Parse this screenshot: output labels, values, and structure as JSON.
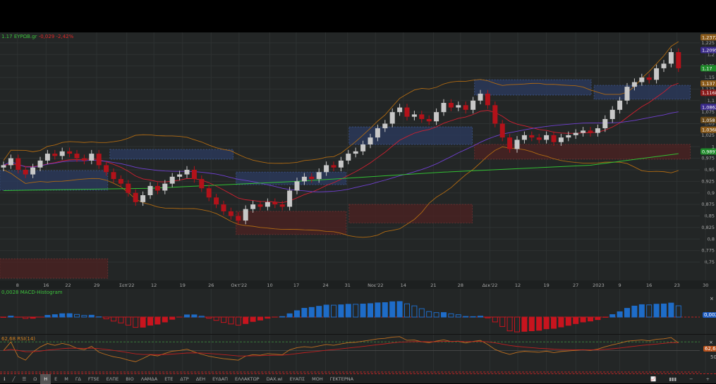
{
  "symbol": {
    "price": "1.17",
    "name": "ΕΥΡΩΒ.gr",
    "change": "-0,029",
    "change_pct": "-2,42%"
  },
  "macd": {
    "label": "MACD-Histogram",
    "value": "0,0028"
  },
  "rsi": {
    "label": "RSI(14)",
    "value": "62,68",
    "level": "50"
  },
  "colors": {
    "up": "#c8c8c8",
    "down": "#b3121a",
    "bb": "#b06a12",
    "green": "#33c033",
    "purple": "#7040d0",
    "red": "#d02030",
    "sar": "#5a5ab8",
    "zone_blue": "#2a3a5c",
    "zone_red": "#4a2222",
    "macd_up": "#1e6cc8",
    "macd_down": "#c8141e",
    "bg": "#232626",
    "grid": "#2e3232"
  },
  "chart_data": {
    "type": "candlestick",
    "ylim": [
      0.74,
      1.25
    ],
    "closes": [
      0.96,
      0.975,
      0.95,
      0.94,
      0.955,
      0.97,
      0.985,
      0.98,
      0.99,
      0.985,
      0.975,
      0.97,
      0.985,
      0.96,
      0.945,
      0.93,
      0.92,
      0.9,
      0.88,
      0.895,
      0.915,
      0.905,
      0.92,
      0.935,
      0.94,
      0.95,
      0.93,
      0.91,
      0.89,
      0.875,
      0.86,
      0.85,
      0.84,
      0.865,
      0.875,
      0.87,
      0.88,
      0.875,
      0.87,
      0.905,
      0.925,
      0.935,
      0.93,
      0.945,
      0.96,
      0.955,
      0.97,
      0.985,
      0.99,
      1.005,
      1.02,
      1.04,
      1.05,
      1.075,
      1.085,
      1.065,
      1.07,
      1.06,
      1.055,
      1.075,
      1.095,
      1.085,
      1.09,
      1.08,
      1.1,
      1.115,
      1.09,
      1.05,
      1.02,
      0.995,
      1.015,
      1.025,
      1.02,
      1.015,
      1.025,
      1.01,
      1.02,
      1.025,
      1.03,
      1.035,
      1.03,
      1.04,
      1.06,
      1.08,
      1.1,
      1.13,
      1.14,
      1.15,
      1.145,
      1.17,
      1.18,
      1.205,
      1.17
    ],
    "long_ma": [
      [
        0,
        0.905
      ],
      [
        20,
        0.91
      ],
      [
        40,
        0.925
      ],
      [
        60,
        0.945
      ],
      [
        80,
        0.96
      ],
      [
        92,
        0.985
      ]
    ],
    "zones": [
      {
        "type": "support",
        "from": -0.5,
        "to": 14.2,
        "low": 0.906,
        "high": 0.948
      },
      {
        "type": "resistance",
        "from": 14.5,
        "to": 31.3,
        "low": 0.973,
        "high": 0.994
      },
      {
        "type": "demand",
        "from": -0.5,
        "to": 14.2,
        "low": 0.715,
        "high": 0.757
      },
      {
        "type": "support",
        "from": 31.7,
        "to": 46.7,
        "low": 0.918,
        "high": 0.945
      },
      {
        "type": "demand",
        "from": 31.7,
        "to": 46.7,
        "low": 0.81,
        "high": 0.86
      },
      {
        "type": "demand",
        "from": 47.1,
        "to": 63.9,
        "low": 0.835,
        "high": 0.875
      },
      {
        "type": "support",
        "from": 47.1,
        "to": 63.9,
        "low": 1.005,
        "high": 1.043
      },
      {
        "type": "support",
        "from": 64.2,
        "to": 80.1,
        "low": 1.112,
        "high": 1.145
      },
      {
        "type": "demand",
        "from": 64.2,
        "to": 93.6,
        "low": 0.973,
        "high": 1.005
      },
      {
        "type": "support",
        "from": 80.5,
        "to": 93.6,
        "low": 1.103,
        "high": 1.133
      }
    ],
    "yticks": [
      "1,225",
      "1,2",
      "1,175",
      "1,15",
      "1,125",
      "1,1",
      "1,075",
      "1,05",
      "1,025",
      "1",
      "0,975",
      "0,95",
      "0,925",
      "0,9",
      "0,875",
      "0,85",
      "0,825",
      "0,8",
      "0,775",
      "0,75"
    ],
    "ytick_values": [
      1.225,
      1.2,
      1.175,
      1.15,
      1.125,
      1.1,
      1.075,
      1.05,
      1.025,
      1,
      0.975,
      0.95,
      0.925,
      0.9,
      0.875,
      0.85,
      0.825,
      0.8,
      0.775,
      0.75
    ],
    "badges": [
      {
        "text": "1,2372",
        "v": 1.2372,
        "c": "#8a5a1a"
      },
      {
        "text": "1,2095",
        "v": 1.2095,
        "c": "#3a2a8a"
      },
      {
        "text": "1,17",
        "v": 1.17,
        "c": "#1f8a2a"
      },
      {
        "text": "1,137",
        "v": 1.137,
        "c": "#8a5a1a"
      },
      {
        "text": "1,1168",
        "v": 1.1168,
        "c": "#8a1a1a"
      },
      {
        "text": "1,0862",
        "v": 1.0862,
        "c": "#3a2a8a"
      },
      {
        "text": "1,058",
        "v": 1.058,
        "c": "#6a4a1a"
      },
      {
        "text": "1,0368",
        "v": 1.0368,
        "c": "#8a5a1a"
      },
      {
        "text": "0,9897",
        "v": 0.9897,
        "c": "#1f8a2a"
      }
    ],
    "xlabels": [
      {
        "t": "8",
        "i": 1.9
      },
      {
        "t": "16",
        "i": 5.8
      },
      {
        "t": "22",
        "i": 8.8
      },
      {
        "t": "29",
        "i": 12.7
      },
      {
        "t": "Σεπ'22",
        "i": 16.8
      },
      {
        "t": "12",
        "i": 20.5
      },
      {
        "t": "19",
        "i": 24.4
      },
      {
        "t": "26",
        "i": 28.3
      },
      {
        "t": "Οκτ'22",
        "i": 32.1
      },
      {
        "t": "10",
        "i": 36.3
      },
      {
        "t": "17",
        "i": 39.9
      },
      {
        "t": "24",
        "i": 43.9
      },
      {
        "t": "31",
        "i": 46.9
      },
      {
        "t": "Νοε'22",
        "i": 50.7
      },
      {
        "t": "14",
        "i": 54.5
      },
      {
        "t": "21",
        "i": 58.6
      },
      {
        "t": "28",
        "i": 62.3
      },
      {
        "t": "Δεκ'22",
        "i": 66.3
      },
      {
        "t": "12",
        "i": 70.1
      },
      {
        "t": "19",
        "i": 74.0
      },
      {
        "t": "27",
        "i": 78.0
      },
      {
        "t": "2023",
        "i": 81.1
      },
      {
        "t": "9",
        "i": 84.0
      },
      {
        "t": "16",
        "i": 88.0
      },
      {
        "t": "23",
        "i": 91.8
      },
      {
        "t": "30",
        "i": 95.7
      }
    ]
  },
  "toolbar": {
    "items": [
      "Ω",
      "H",
      "E",
      "M",
      "ΓΔ",
      "FTSE",
      "ΕΛΠΕ",
      "ΒΙΟ",
      "ΛΑΜΔΑ",
      "ΕΤΕ",
      "ΔΤΡ",
      "ΔΕΗ",
      "ΕΥΔΑΠ",
      "ΕΛΛΑΚΤΩΡ",
      "DAX.wi",
      "ΕΥΑΠΣ",
      "ΜΟΗ",
      "ΓΕΚΤΕΡΝΑ"
    ],
    "active": "H"
  }
}
